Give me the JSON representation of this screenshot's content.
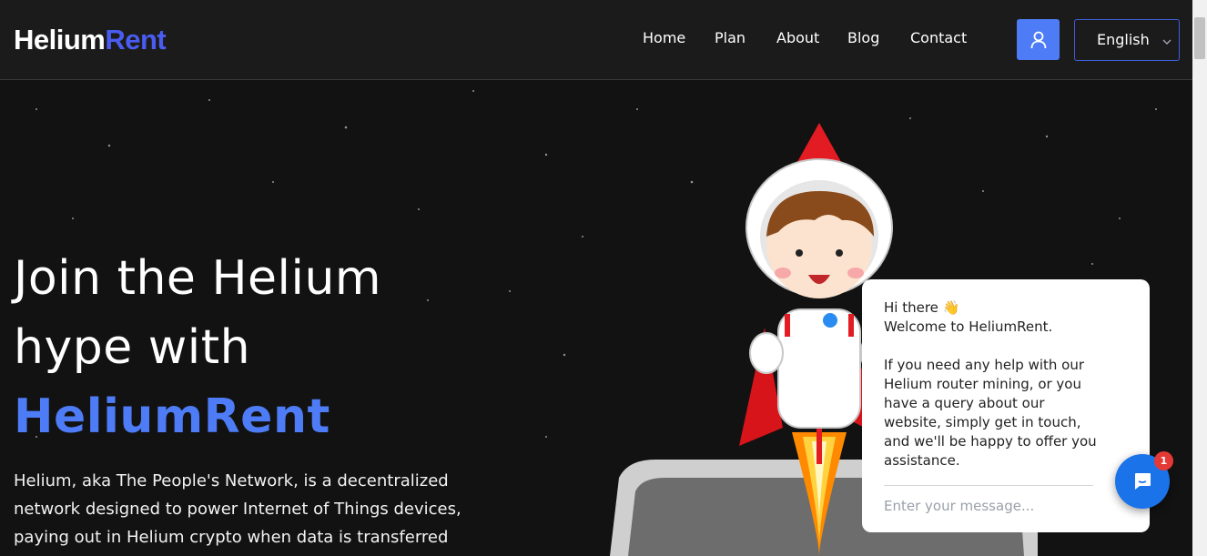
{
  "brand": {
    "part1": "Helium",
    "part2": "Rent"
  },
  "nav": {
    "items": [
      {
        "label": "Home"
      },
      {
        "label": "Plan"
      },
      {
        "label": "About"
      },
      {
        "label": "Blog"
      },
      {
        "label": "Contact"
      }
    ],
    "user_icon": "user-icon",
    "language": {
      "value": "English",
      "icon": "chevron-down-icon"
    }
  },
  "hero": {
    "line1": "Join the Helium",
    "line2": "hype with",
    "brand": "HeliumRent",
    "description": "Helium, aka The People's Network, is a decentralized network designed to power Internet of Things devices, paying out in Helium crypto when data is transferred across a hotspot."
  },
  "chat": {
    "greeting": "Hi there 👋",
    "message": "Welcome to HeliumRent.\n\nIf you need any help with our Helium router mining, or you have a query about our website, simply get in touch, and we'll be happy to offer you assistance.",
    "placeholder": "Enter your message...",
    "badge_count": "1",
    "launcher_icon": "chat-bubble-icon"
  },
  "colors": {
    "accent": "#4d7cf6",
    "logo_accent": "#4a5cf0",
    "background": "#121212",
    "chat_launcher": "#1a73e8",
    "badge": "#e53935"
  }
}
